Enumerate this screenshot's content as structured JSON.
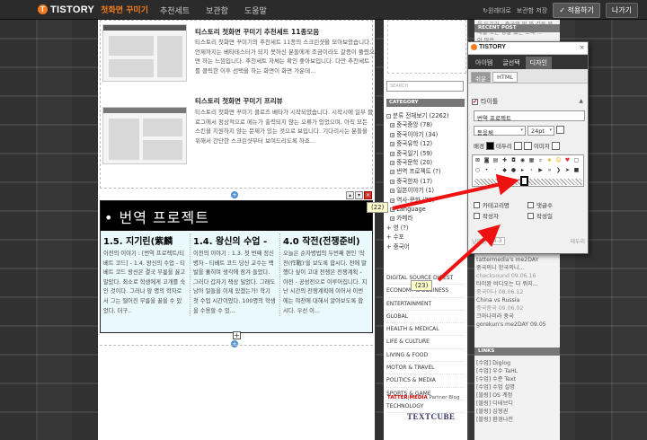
{
  "topbar": {
    "logo_mark": "T",
    "logo_text": "TISTORY",
    "logo_sub": "첫화면 꾸미기",
    "nav": [
      "추천세트",
      "보관함",
      "도움말"
    ],
    "revert_label": "원래대로",
    "save_label": "보관함 저장",
    "apply_label": "✓ 적용하기",
    "exit_label": "나가기"
  },
  "posts": [
    {
      "title": "티스토리 첫화면 꾸미기 추천세트 11종모음",
      "body": "티스토리 첫화면 꾸미기의 추천세트 11종의 스크린샷을 모아보았습니다. 언제까지는 베타테스터가 되지 못하신 분들에게 조금이라도 갈증이 풀렸으면 하는 느낌입니다. 추천세트 자체는 확인 좋아보입니다. 다만 추천세트를 클릭한 이후 선택을 하는 화면이 화면 가운데..."
    },
    {
      "title": "티스토리 첫화면 꾸미기 프리뷰",
      "body": "티스토리 첫화면 꾸미기 클로즈 베타가 시작되었습니다. 시작시에 일부 블로그에서 정상적으로 메뉴가 출력되지 않는 오류가 있었으며, 아직 모든 스킨을 지원하지 않는 문제가 있는 것으로 보입니다. 기다리시는 분들을 위해서 간단한 스크린샷부터 보여드리도록 하죠..."
    }
  ],
  "category_block": {
    "header": "• 번역 프로젝트",
    "columns": [
      {
        "title": "1.5. 지기린(紫麟",
        "body": "이전의 이야기 : [번역 프로젝트/티베트 코드] - 1.4. 왕신의 수업 - 티베트 코드 왕신은 결국 무릎을 꿇고 말았다. 최소로 학생에게 고개를 숙인 것이다. 그러나 앞 명의 학자로서 그는 떨어진 무릎을 꿇을 수 있었다. 더구.."
      },
      {
        "title": "1.4. 왕신의 수업 -",
        "body": "이전의 이야기 : 1.3. 첫 번째 정신병자 - 티베트 코드 당신 교수는 백발을 휼히며 생각에 잠겨 들었다. 그러다 갑자기 책상 덜었다. 그래도 남아 일들을 이제 있겠는가! 학기 첫 수업 시간이었다. 100명의 학생을 수용할 수 있..."
      },
      {
        "title": "4.0 작전(전쟁준비)",
        "body": "오늘은 순자병법의 두번째 편인 '작전(作戰)'을 보도록 합시다. 전에 말했다 싶이 고대 전쟁은 전쟁계획 - 야전 - 공성전으로 이루어집니다. 지난 시간의 전쟁계획에 이어서 이번에는 야전에 대해서 알아보도록 합시다. 우선 이..."
      }
    ],
    "add_label": "+"
  },
  "sidebar": {
    "intro": "앞 문제 : 중국 중국이 갈 수 있는 문화가 필요합니다 ' 와 같은 문제를 갖고 있는 중국에 하는게 나는 그대로 실은 ...",
    "search_placeholder": "SEARCH",
    "category_header": "CATEGORY",
    "categories": [
      "분류 전체보기 (2262)",
      "중국중앙 (78)",
      "중국이야기 (34)",
      "중국유학 (12)",
      "중국일기 (59)",
      "중국문학 (20)",
      "번역 프로젝트 (?)",
      "중국한자 (17)",
      "일본이야기 (1)",
      "역사-문화 (73)",
      "Language",
      "카메라"
    ],
    "misc": [
      "+ 영 (?)",
      "+ 수포",
      "+ 중국어"
    ],
    "tags": [
      "DIGITAL SOURCE DIGEST",
      "ECONOMY & BUSINESS",
      "ENTERTAINMENT",
      "GLOBAL",
      "HEALTH & MEDICAL",
      "LIFE & CULTURE",
      "LIVING & FOOD",
      "MOTOR & TRAVEL",
      "POLITICS & MEDIA",
      "SPORTS & GAME",
      "TECHNOLOGY"
    ],
    "partner_prefix": "TATTER",
    "partner_mid": "MEDIA",
    "partner_suffix": " Partner Blog",
    "textcube": "TEXTCUBE"
  },
  "rsidebar": {
    "top_text": [
      "을 도호라 : 중국의 안 와 같은 문제를 보는 정말 있는 고대 ...",
      "이 많은 ..."
    ],
    "recent_post_header": "RECENT POST",
    "recent_comments": [
      "tattermedia's me2DAY",
      "중국의니 한국의니...",
      "checksound 09.06.16",
      "타이완 비디오는 다 뭐지...",
      "중국어나 08.06.12",
      "China vs Russia",
      "중국중국 09.06.02",
      "크아나미라 중국",
      "gorekun's me2DAY 09.05"
    ],
    "links_header": "LINKS",
    "links": [
      "[수업] Diglog",
      "[수업] 우수 TaHL",
      "[수업] 수준 Text",
      "[수업] 수업 설명",
      "[블링] OS 계정",
      "[블링] 디테브디",
      "[블링] 심형권",
      "[블링] 환경나전"
    ]
  },
  "panel": {
    "logo": "TISTORY",
    "close": "×",
    "tabs": [
      "아이템",
      "글선택",
      "디자인"
    ],
    "active_tab": 2,
    "subtabs": [
      "쉬운",
      "HTML"
    ],
    "section_label": "타이틀",
    "title_value": "번역 프로젝트",
    "font_family": "돋움체",
    "font_size": "24pt",
    "color_label_bg": "배경",
    "color_label_border": "테두리",
    "color_label_image": "이미지",
    "options": [
      "카테고리명",
      "댓글수",
      "작성자",
      "작성일"
    ],
    "footer_label": "날짜형",
    "footer_value": "4-3",
    "footer_right": "테두리"
  },
  "callouts": [
    "(22)",
    "(23)"
  ]
}
